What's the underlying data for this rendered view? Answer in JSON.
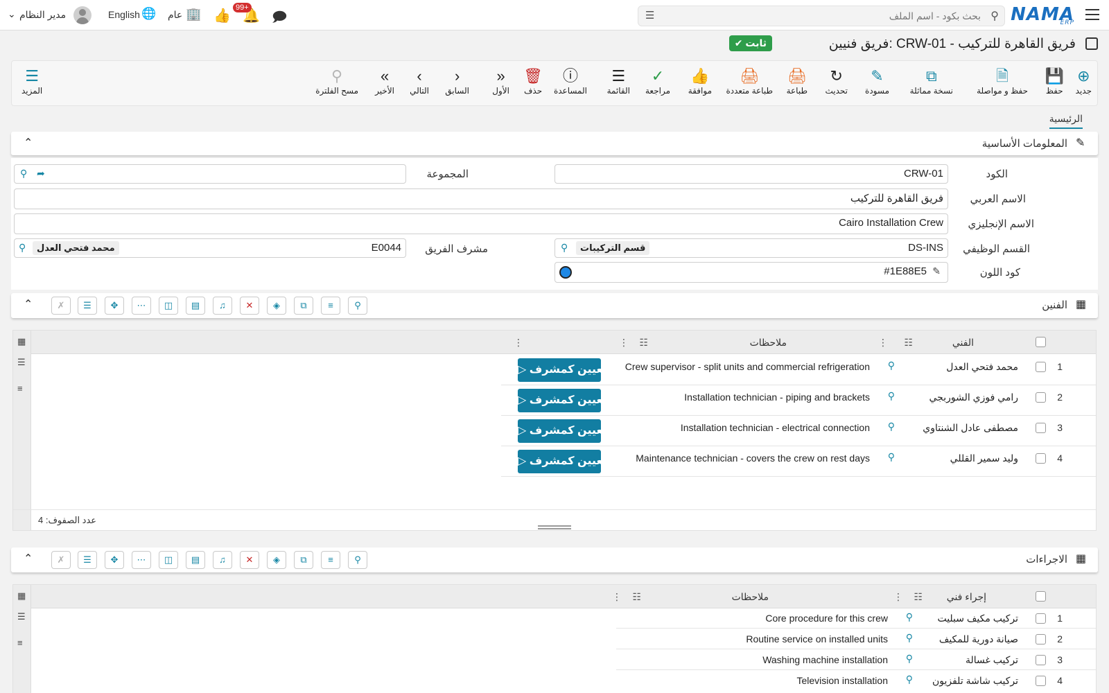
{
  "topbar": {
    "logo": "NAMA",
    "logo_sub": "ERP",
    "search_placeholder": "بحث بكود - اسم الملف",
    "notifications_badge": "99+",
    "company": "عام",
    "language": "English",
    "user": "مدير النظام"
  },
  "title": {
    "text": "فريق فنيين: CRW-01 - فريق القاهرة للتركيب",
    "status": "ثابت"
  },
  "toolbar": {
    "new": "جديد",
    "save": "حفظ",
    "save_continue": "حفظ و مواصلة",
    "duplicate": "نسخة مماثلة",
    "draft": "مسودة",
    "refresh": "تحديث",
    "print": "طباعة",
    "multi_print": "طباعة متعددة",
    "approve": "موافقة",
    "review": "مراجعة",
    "list": "القائمة",
    "help": "المساعدة",
    "delete": "حذف",
    "first": "الأول",
    "previous": "السابق",
    "next": "التالي",
    "last": "الأخير",
    "clear_filter": "مسح الفلترة",
    "more": "المزيد"
  },
  "tabs": {
    "main": "الرئيسية"
  },
  "basic_info": {
    "title": "المعلومات الأساسية",
    "code_label": "الكود",
    "code_value": "CRW-01",
    "group_label": "المجموعة",
    "arabic_name_label": "الاسم العربي",
    "arabic_name_value": "فريق القاهرة للتركيب",
    "english_name_label": "الاسم الإنجليزي",
    "english_name_value": "Cairo Installation Crew",
    "department_label": "القسم الوظيفي",
    "department_code": "DS-INS",
    "department_name": "قسم التركيبات",
    "supervisor_label": "مشرف الفريق",
    "supervisor_code": "E0044",
    "supervisor_name": "محمد فتحي العدل",
    "color_label": "كود اللون",
    "color_value": "#1E88E5"
  },
  "technicians": {
    "title": "الفنين",
    "col_technician": "الفني",
    "col_notes": "ملاحظات",
    "assign_label": "تعيين كمشرف",
    "row_count_label": "عدد الصفوف: 4",
    "rows": [
      {
        "num": "1",
        "name": "محمد فتحي العدل",
        "notes": "Crew supervisor - split units and commercial refrigeration"
      },
      {
        "num": "2",
        "name": "رامي فوزي الشوربجي",
        "notes": "Installation technician - piping and brackets"
      },
      {
        "num": "3",
        "name": "مصطفى عادل الشنتاوي",
        "notes": "Installation technician - electrical connection"
      },
      {
        "num": "4",
        "name": "وليد سمير القللي",
        "notes": "Maintenance technician - covers the crew on rest days"
      }
    ]
  },
  "procedures": {
    "title": "الاجراءات",
    "col_procedure": "إجراء فني",
    "col_notes": "ملاحظات",
    "rows": [
      {
        "num": "1",
        "name": "تركيب مكيف سبليت",
        "notes": "Core procedure for this crew"
      },
      {
        "num": "2",
        "name": "صيانة دورية للمكيف",
        "notes": "Routine service on installed units"
      },
      {
        "num": "3",
        "name": "تركيب غسالة",
        "notes": "Washing machine installation"
      },
      {
        "num": "4",
        "name": "تركيب شاشة تلفزيون",
        "notes": "Television installation"
      }
    ]
  }
}
